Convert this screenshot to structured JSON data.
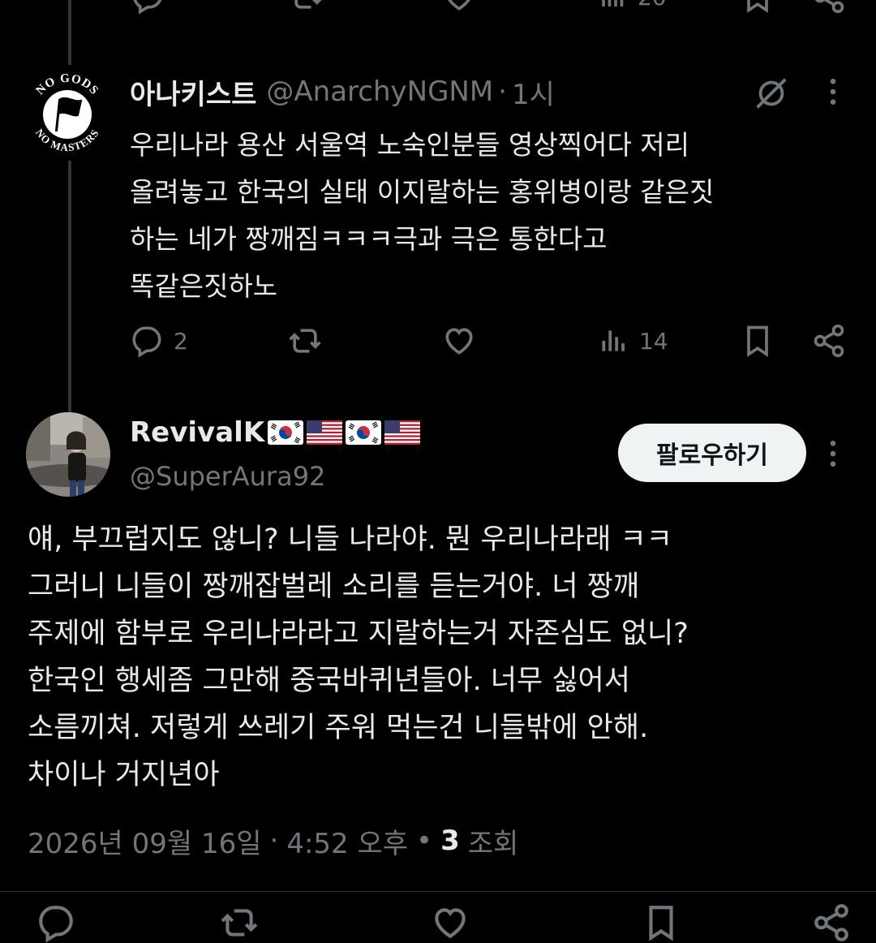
{
  "reply_tweet": {
    "display_name": "아나키스트",
    "handle": "@AnarchyNGNM",
    "separator": "·",
    "time": "1시",
    "text": "우리나라 용산 서울역 노숙인분들 영상찍어다 저리\n올려놓고 한국의 실태 이지랄하는 홍위병이랑 같은짓\n하는 네가 짱깨짐ㅋㅋㅋ극과 극은 통한다고\n똑같은짓하노",
    "avatar_logo_top": "NO GODS",
    "avatar_logo_bottom": "NO MASTERS",
    "actions": {
      "reply_count": "2",
      "repost_count": "",
      "like_count": "",
      "views_count": "14"
    }
  },
  "main_tweet": {
    "display_name": "RevivalK",
    "flags": [
      "kr-flag",
      "us-flag",
      "kr-flag",
      "us-flag"
    ],
    "handle": "@SuperAura92",
    "follow_label": "팔로우하기",
    "text": "얘, 부끄럽지도 않니? 니들 나라야. 뭔 우리나라래 ㅋㅋ\n그러니 니들이 짱깨잡벌레 소리를 듣는거야. 너 짱깨\n주제에 함부로 우리나라라고 지랄하는거 자존심도 없니?\n한국인 행세좀 그만해 중국바퀴년들아. 너무 싫어서\n소름끼쳐. 저렇게 쓰레기 주워 먹는건 니들밖에 안해.\n차이나 거지년아",
    "date": "2026년 09월 16일",
    "dot1": "·",
    "time": "4:52 오후",
    "dot2": "•",
    "views_number": "3",
    "views_label": "조회"
  },
  "top_partial_actions": {
    "views_count": "20"
  },
  "colors": {
    "background": "#000000",
    "text_primary": "#e7e9ea",
    "text_secondary": "#71767b",
    "follow_button_bg": "#eff3f4"
  }
}
